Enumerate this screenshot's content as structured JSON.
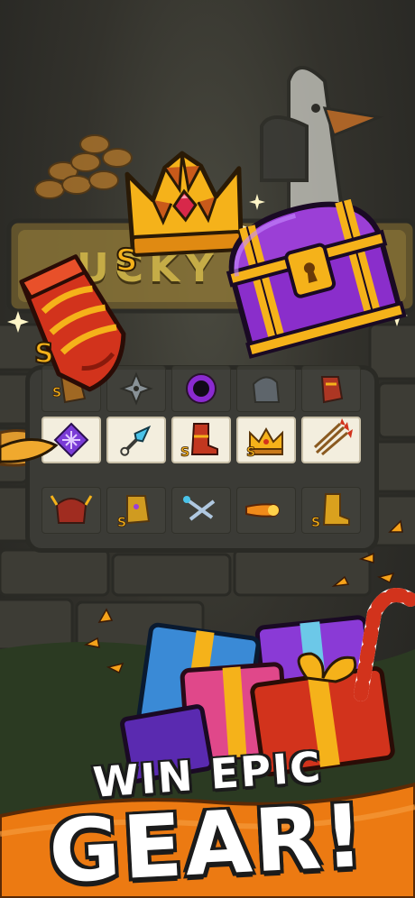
{
  "caption": {
    "line1": "WIN EPIC",
    "line2": "GEAR!"
  },
  "sign_text": "UCKY S",
  "colors": {
    "gold": "#f5b21a",
    "purple": "#9b3fd6",
    "red": "#d2331c",
    "banner": "#ec7a12"
  },
  "featured_items": [
    {
      "icon": "crown-icon"
    },
    {
      "icon": "gauntlet-icon"
    },
    {
      "icon": "treasure-chest-icon"
    }
  ],
  "slot_rows": [
    [
      "gauntlet-icon",
      "shuriken-icon",
      "dark-portal-icon",
      "stone-icon",
      "gauntlet-icon"
    ],
    [
      "rune-shield-icon",
      "kunai-icon",
      "boot-icon",
      "crown-icon",
      "triple-arrow-icon"
    ],
    [
      "demon-helmet-icon",
      "gold-gauntlet-icon",
      "twin-daggers-icon",
      "fireball-icon",
      "gold-boot-icon"
    ]
  ]
}
